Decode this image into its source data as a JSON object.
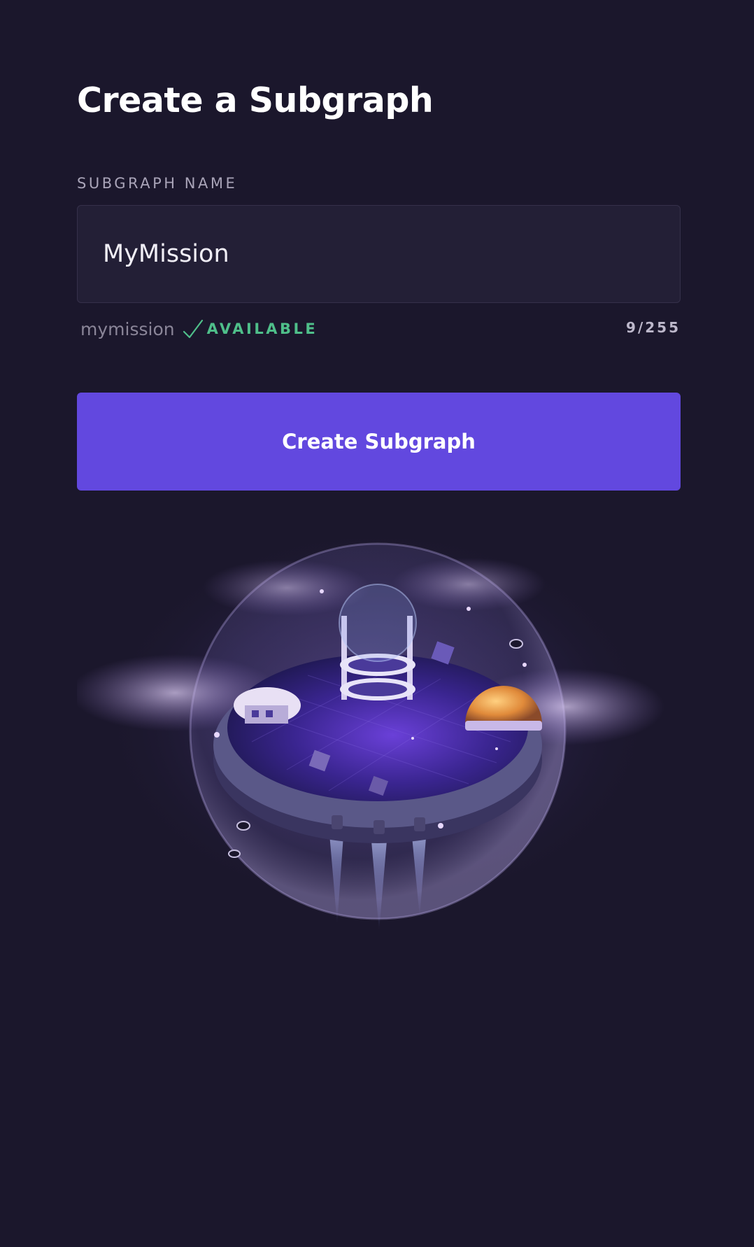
{
  "page": {
    "title": "Create a Subgraph"
  },
  "form": {
    "name_label": "SUBGRAPH NAME",
    "name_value": "MyMission",
    "slug": "mymission",
    "status": "AVAILABLE",
    "char_count": "9/255",
    "submit_label": "Create Subgraph"
  },
  "icons": {
    "status_icon": "check-icon",
    "hero_image": "floating-island-illustration"
  },
  "colors": {
    "background": "#1b172c",
    "input_background": "#231f36",
    "accent": "#6248df",
    "success": "#4fbf8a"
  }
}
